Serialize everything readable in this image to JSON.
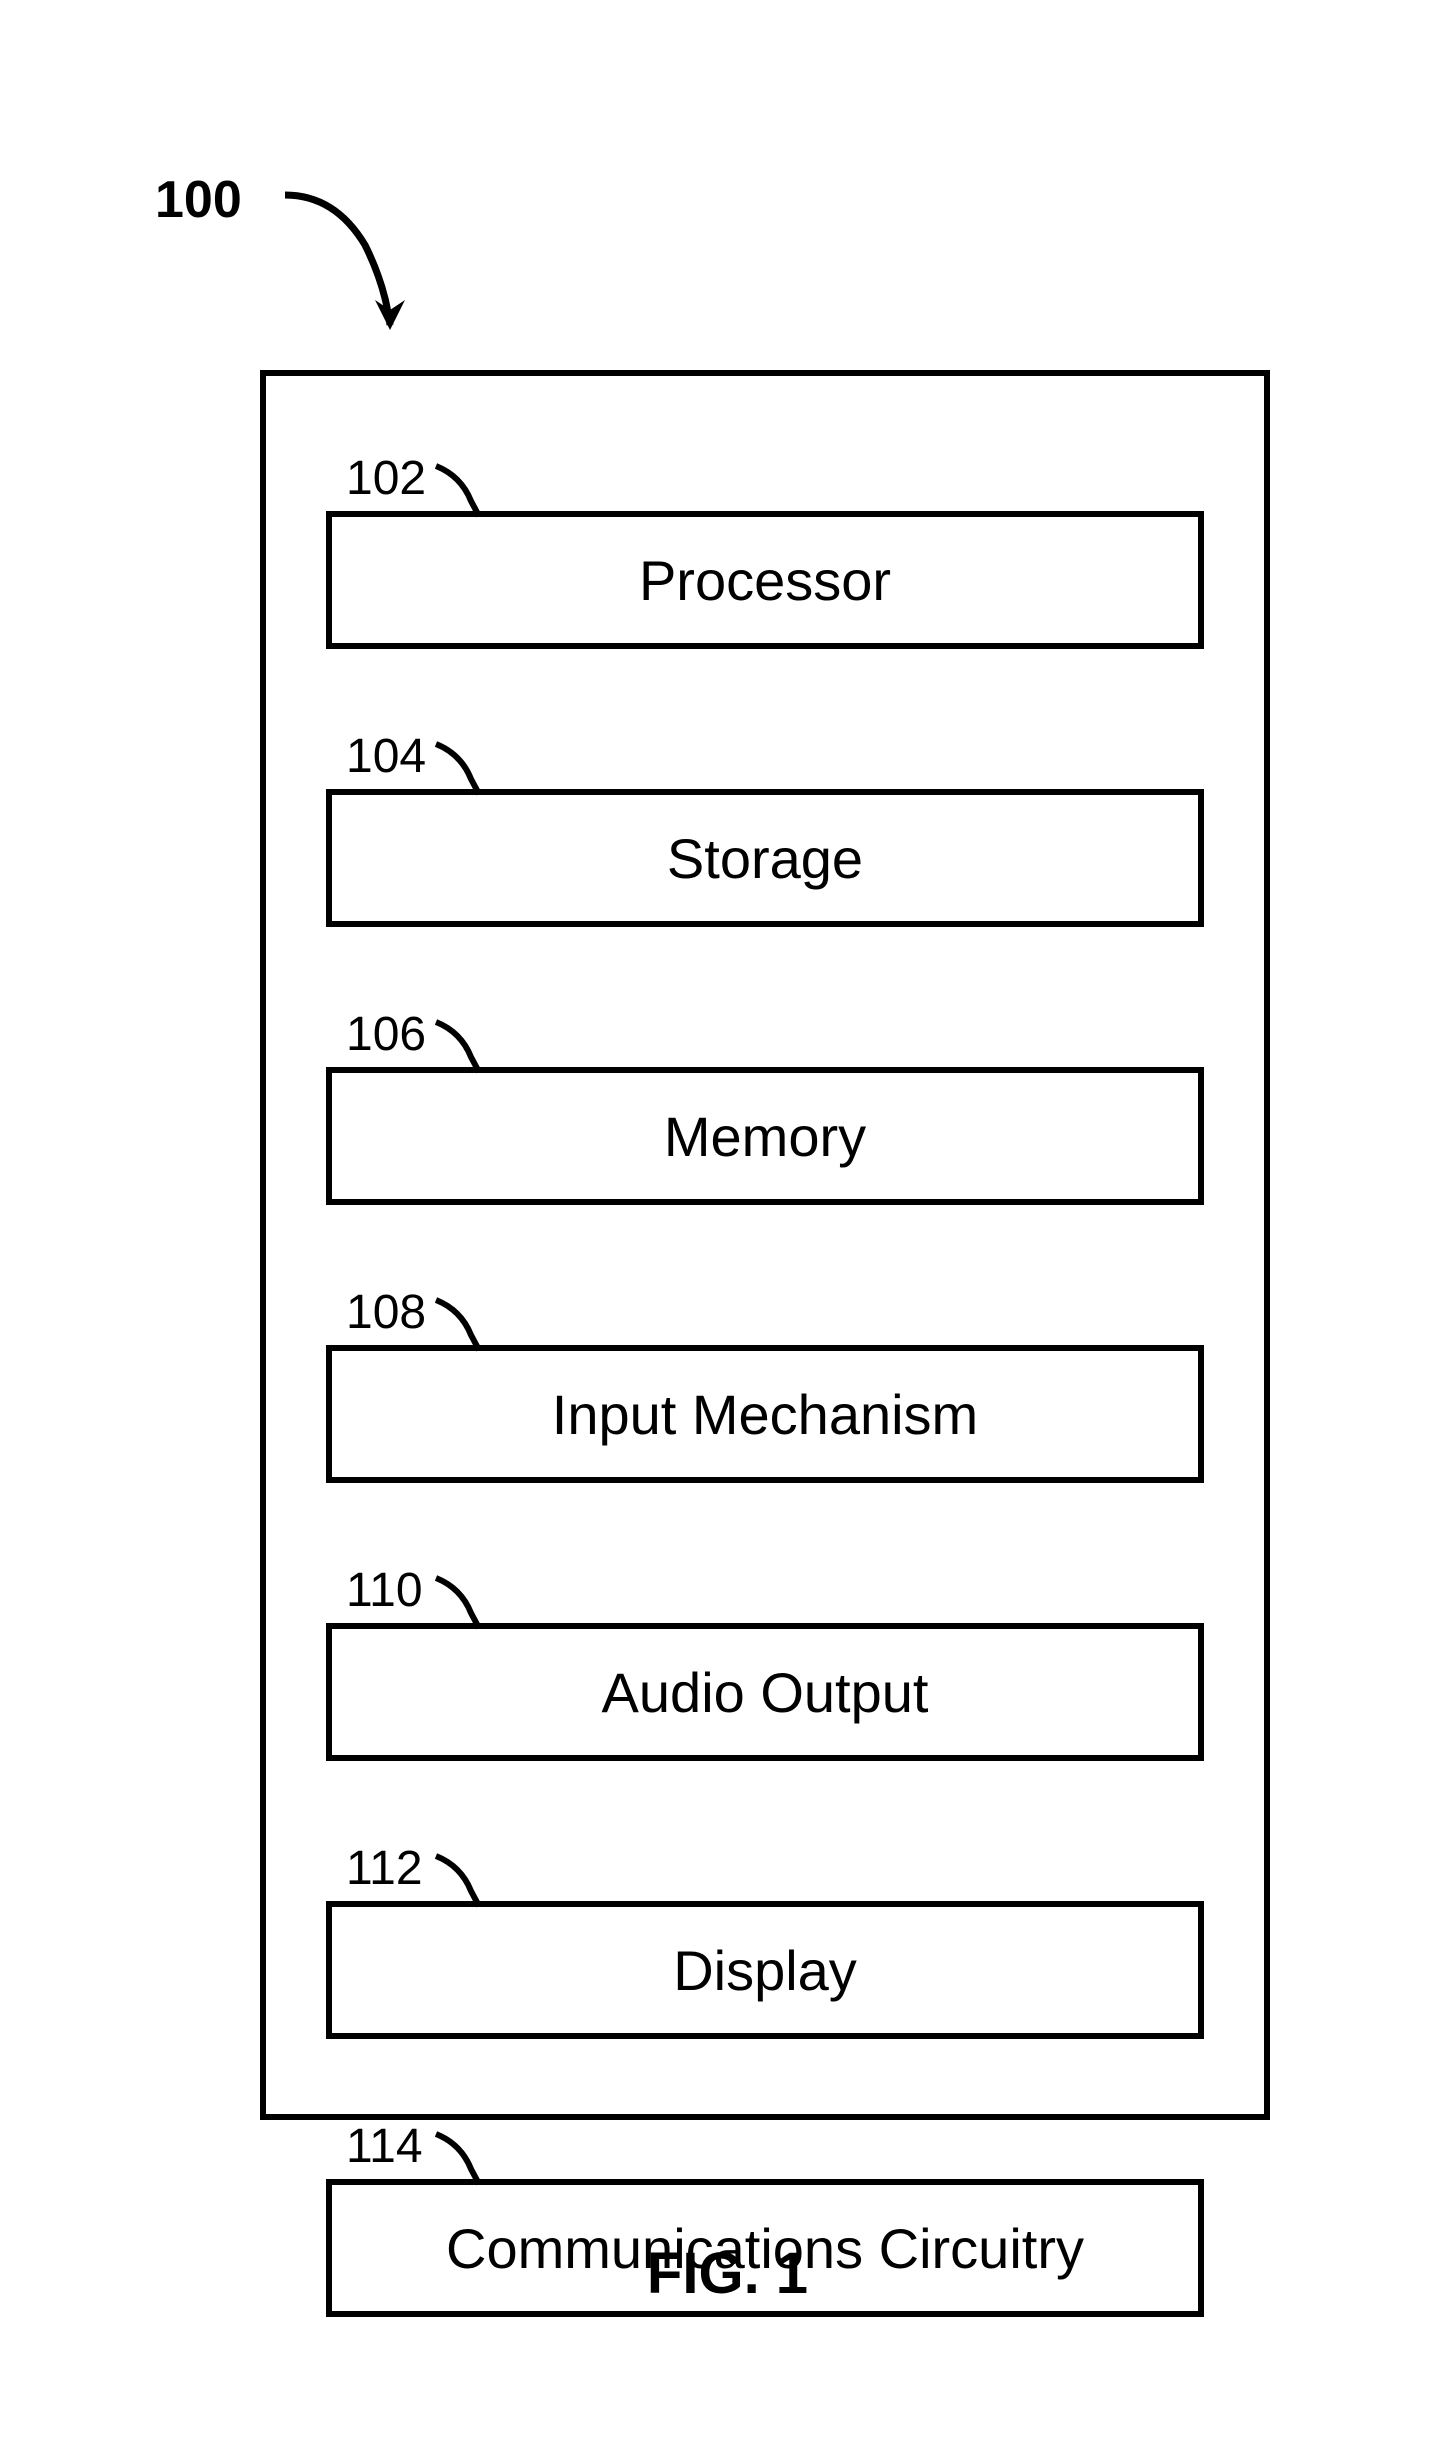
{
  "figure": {
    "mainRef": "100",
    "caption": "FIG. 1",
    "blocks": [
      {
        "ref": "102",
        "label": "Processor"
      },
      {
        "ref": "104",
        "label": "Storage"
      },
      {
        "ref": "106",
        "label": "Memory"
      },
      {
        "ref": "108",
        "label": "Input Mechanism"
      },
      {
        "ref": "110",
        "label": "Audio Output"
      },
      {
        "ref": "112",
        "label": "Display"
      },
      {
        "ref": "114",
        "label": "Communications Circuitry"
      }
    ]
  }
}
